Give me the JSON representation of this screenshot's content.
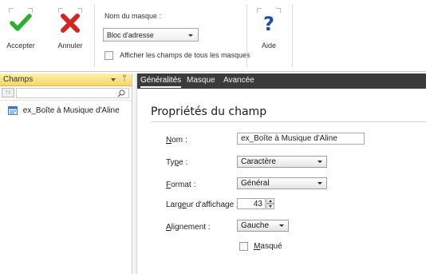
{
  "ribbon": {
    "accept_label": "Accepter",
    "cancel_label": "Annuler",
    "mask_name_label": "Nom du masque :",
    "mask_select_value": "Bloc d'adresse",
    "show_all_masks_label": "Afficher les champs de tous les masques",
    "help_label": "Aide"
  },
  "left_panel": {
    "title": "Champs",
    "sort_label": "↑↓",
    "pin_glyph": "ᛘ",
    "fields": [
      "ex_Boîte à Musique d'Aline"
    ]
  },
  "tabs": [
    {
      "label": "Généralités",
      "active": true
    },
    {
      "label": "Masque",
      "active": false
    },
    {
      "label": "Avancée",
      "active": false
    }
  ],
  "properties": {
    "section_title": "Propriétés du champ",
    "name": {
      "label_pre": "",
      "label_u": "N",
      "label_post": "om :",
      "value": "ex_Boîte à Musique d'Aline"
    },
    "type": {
      "label_pre": "Ty",
      "label_u": "p",
      "label_post": "e :",
      "value": "Caractère"
    },
    "format": {
      "label_pre": "",
      "label_u": "F",
      "label_post": "ormat :",
      "value": "Général"
    },
    "display_width": {
      "label_pre": "Larg",
      "label_u": "e",
      "label_post": "ur d'affichage :",
      "value": "43"
    },
    "alignment": {
      "label_pre": "",
      "label_u": "A",
      "label_post": "lignement :",
      "value": "Gauche"
    },
    "hidden": {
      "label_pre": "",
      "label_u": "M",
      "label_post": "asqué",
      "checked": false
    }
  },
  "colors": {
    "accept": "#2eae2e",
    "cancel": "#d42525",
    "help": "#1f4f9e",
    "panel_header": "#f7dd7a",
    "tab_bar": "#3b3b3b"
  },
  "icons": {
    "accept": "check-icon",
    "cancel": "x-icon",
    "help": "question-icon",
    "search": "search-icon",
    "field": "field-icon"
  }
}
